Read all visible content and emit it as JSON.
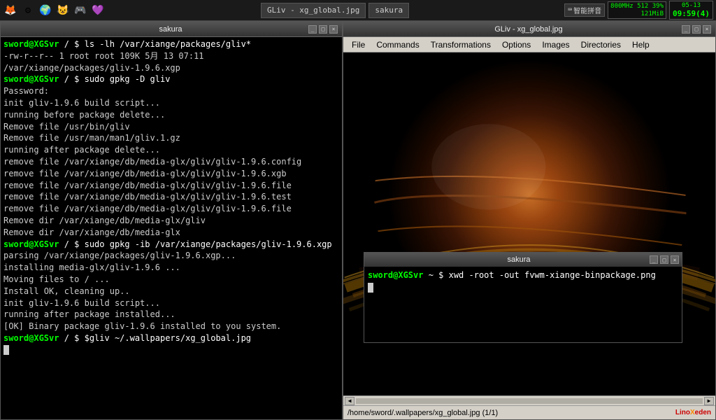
{
  "taskbar": {
    "icons": [
      "🦊",
      "⚙",
      "🌍",
      "😺",
      "🎮",
      "💜"
    ],
    "apps": [
      "GLiv",
      "sakura"
    ],
    "ime": {
      "icon": "⌨",
      "text": "智能拼音"
    },
    "cpu": {
      "line1": "800MHz 512 39%",
      "line2": "121MiB",
      "bar_colors": [
        "#00cc00",
        "#0088ff",
        "#00cc00"
      ]
    },
    "time": {
      "time": "09:59(4)",
      "date": "05-13"
    }
  },
  "terminal_left": {
    "title": "sakura",
    "btn_labels": [
      "_",
      "□",
      "×"
    ],
    "lines": [
      {
        "type": "prompt",
        "text": "sword@XGSvr",
        "suffix": " / $ ",
        "cmd": "ls -lh /var/xiange/packages/gliv*"
      },
      {
        "type": "output",
        "text": "-rw-r--r-- 1 root root 109K  5月 13 07:11 /var/xiange/packages/gliv-1.9.6.xgp"
      },
      {
        "type": "prompt",
        "text": "sword@XGSvr",
        "suffix": " / $ ",
        "cmd": "sudo gpkg -D gliv"
      },
      {
        "type": "output",
        "text": "Password:"
      },
      {
        "type": "output",
        "text": "init gliv-1.9.6 build script..."
      },
      {
        "type": "output",
        "text": "running before package delete..."
      },
      {
        "type": "output",
        "text": "Remove file /usr/bin/gliv"
      },
      {
        "type": "output",
        "text": "Remove file /usr/man/man1/gliv.1.gz"
      },
      {
        "type": "output",
        "text": "running after package delete..."
      },
      {
        "type": "output",
        "text": "remove file /var/xiange/db/media-glx/gliv/gliv-1.9.6.config"
      },
      {
        "type": "output",
        "text": "remove file /var/xiange/db/media-glx/gliv/gliv-1.9.6.xgb"
      },
      {
        "type": "output",
        "text": "remove file /var/xiange/db/media-glx/gliv/gliv-1.9.6.file"
      },
      {
        "type": "output",
        "text": "remove file /var/xiange/db/media-glx/gliv/gliv-1.9.6.test"
      },
      {
        "type": "output",
        "text": "remove file /var/xiange/db/media-glx/gliv/gliv-1.9.6.file"
      },
      {
        "type": "output",
        "text": "Remove dir /var/xiange/db/media-glx/gliv"
      },
      {
        "type": "output",
        "text": "Remove dir /var/xiange/db/media-glx"
      },
      {
        "type": "prompt",
        "text": "sword@XGSvr",
        "suffix": " / $ ",
        "cmd": "sudo gpkg -ib /var/xiange/packages/gliv-1.9.6.xgp"
      },
      {
        "type": "output",
        "text": "parsing /var/xiange/packages/gliv-1.9.6.xgp..."
      },
      {
        "type": "output",
        "text": "installing media-glx/gliv-1.9.6 ..."
      },
      {
        "type": "output",
        "text": "Moving files to / ..."
      },
      {
        "type": "output",
        "text": "Install OK, cleaning up.."
      },
      {
        "type": "output",
        "text": "init gliv-1.9.6 build script..."
      },
      {
        "type": "output",
        "text": "running after package installed..."
      },
      {
        "type": "output",
        "text": "[OK] Binary package gliv-1.9.6 installed to you system."
      },
      {
        "type": "prompt",
        "text": "sword@XGSvr",
        "suffix": " / $ ",
        "cmd": "$gliv ~/.wallpapers/xg_global.jpg"
      },
      {
        "type": "cursor",
        "text": ""
      }
    ]
  },
  "gliv_window": {
    "title": "GLiv - xg_global.jpg",
    "btn_labels": [
      "_",
      "□",
      "×"
    ],
    "menu_items": [
      "File",
      "Commands",
      "Transformations",
      "Options",
      "Images",
      "Directories",
      "Help"
    ],
    "statusbar": {
      "path": "/home/sword/.wallpapers/xg_global.jpg (1/1)",
      "logo": "LinoXeden"
    }
  },
  "terminal_small": {
    "title": "sakura",
    "btn_labels": [
      "_",
      "□",
      "×"
    ],
    "prompt": "sword@XGSvr",
    "prompt_suffix": " ~ $ ",
    "cmd": "xwd -root -out fvwm-xiange-binpackage.png"
  }
}
